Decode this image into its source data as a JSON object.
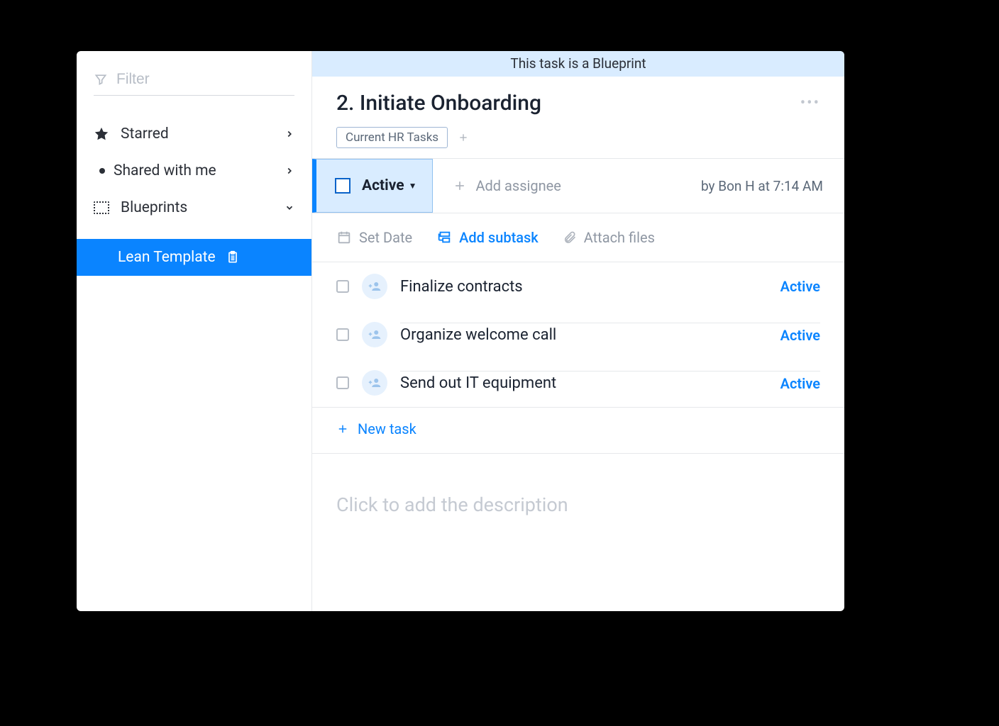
{
  "sidebar": {
    "filter_placeholder": "Filter",
    "items": [
      {
        "label": "Starred",
        "icon": "star-icon"
      },
      {
        "label": "Shared with me",
        "icon": "bullet-icon"
      },
      {
        "label": "Blueprints",
        "icon": "dashed-box-icon"
      }
    ],
    "blueprint_child": {
      "label": "Lean Template"
    }
  },
  "banner": "This task is a Blueprint",
  "task": {
    "title": "2. Initiate Onboarding",
    "tag": "Current HR Tasks",
    "status": "Active",
    "add_assignee": "Add assignee",
    "byline": "by Bon H at 7:14 AM"
  },
  "actions": {
    "set_date": "Set Date",
    "add_subtask": "Add subtask",
    "attach_files": "Attach files"
  },
  "subtasks": [
    {
      "title": "Finalize contracts",
      "status": "Active"
    },
    {
      "title": "Organize welcome call",
      "status": "Active"
    },
    {
      "title": "Send out IT equipment",
      "status": "Active"
    }
  ],
  "new_task": "New task",
  "description_placeholder": "Click to add the description",
  "colors": {
    "accent": "#0a84ff",
    "banner_bg": "#d9ecff"
  }
}
